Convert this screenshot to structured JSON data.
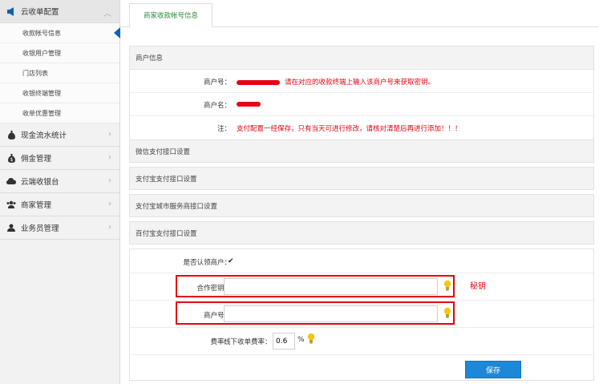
{
  "sidebar": {
    "groups": [
      {
        "label": "云收单配置",
        "icon": "megaphone-icon",
        "expanded": true,
        "items": [
          {
            "label": "收款帐号信息",
            "active": true
          },
          {
            "label": "收银用户管理"
          },
          {
            "label": "门店列表"
          },
          {
            "label": "收银终端管理"
          },
          {
            "label": "收单优惠管理"
          }
        ]
      },
      {
        "label": "现金流水统计",
        "icon": "money-bag-icon"
      },
      {
        "label": "佣金管理",
        "icon": "coin-bag-icon"
      },
      {
        "label": "云端收银台",
        "icon": "cloud-icon"
      },
      {
        "label": "商家管理",
        "icon": "users-icon"
      },
      {
        "label": "业务员管理",
        "icon": "user-icon"
      }
    ]
  },
  "tabs": [
    {
      "label": "商家收款帐号信息"
    }
  ],
  "merchant_info": {
    "title": "商户信息",
    "merchant_no_label": "商户号：",
    "merchant_no_hint": "请在对应的收款终端上输入该商户号来获取密钥。",
    "merchant_name_label": "商户名：",
    "note_label": "注：",
    "note_text": "支付配置一经保存，只有当天可进行修改，请核对清楚后再进行添加！！！"
  },
  "sections": [
    {
      "label": "微信支付接口设置"
    },
    {
      "label": "支付宝支付接口设置"
    },
    {
      "label": "支付宝城市服务商接口设置"
    },
    {
      "label": "百付宝支付接口设置"
    }
  ],
  "baifubao": {
    "default_merchant_label": "是否认领商户：",
    "default_merchant_checked": true,
    "key_label": "合作密钥：",
    "key_value": "",
    "merchant_no_label": "商户号：",
    "merchant_no_value": "",
    "rate_label": "费率：",
    "offline_rate_label": "线下收单费率：",
    "offline_rate_value": "0.6",
    "rate_unit": "%",
    "save_label": "保存"
  },
  "annotation": {
    "text": "秘钥"
  },
  "colors": {
    "accent_blue": "#1e88d8",
    "alert_red": "#e60012",
    "tab_green": "#2a8a3a"
  }
}
